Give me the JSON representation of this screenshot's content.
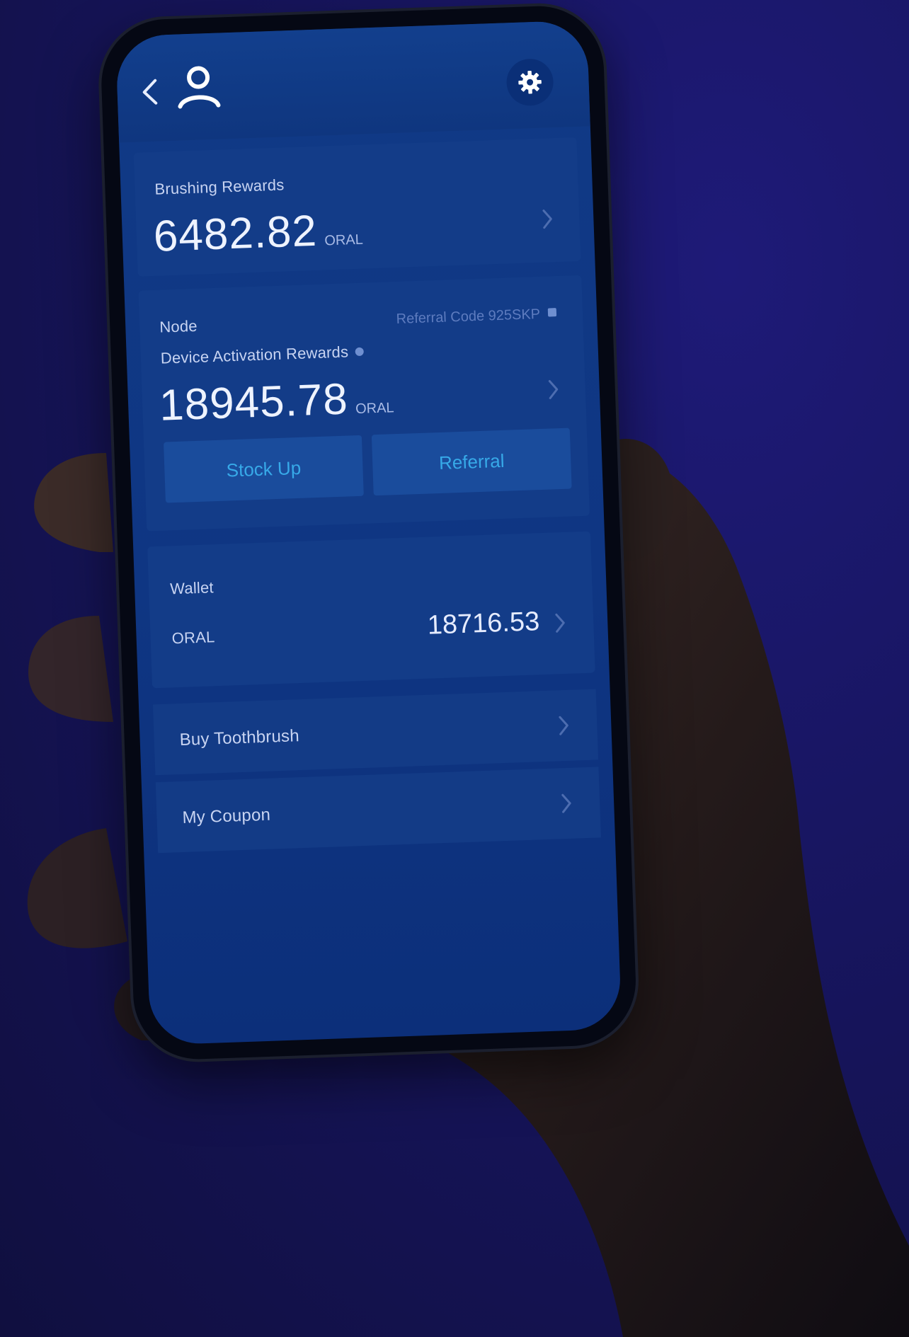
{
  "header": {
    "back_icon": "chevron-left-icon",
    "profile_icon": "user-icon",
    "settings_icon": "gear-icon"
  },
  "brushing": {
    "label": "Brushing Rewards",
    "amount": "6482.82",
    "unit": "ORAL"
  },
  "node": {
    "label": "Node",
    "referral_code": "Referral Code 925SKP",
    "activation_label": "Device Activation Rewards",
    "amount": "18945.78",
    "unit": "ORAL",
    "stock_up_label": "Stock Up",
    "referral_label": "Referral"
  },
  "wallet": {
    "label": "Wallet",
    "coin": "ORAL",
    "amount": "18716.53"
  },
  "menu": {
    "buy_label": "Buy Toothbrush",
    "coupon_label": "My Coupon"
  },
  "colors": {
    "background": "#17155e",
    "screen": "#103a86",
    "button_text": "#37a9e8"
  }
}
